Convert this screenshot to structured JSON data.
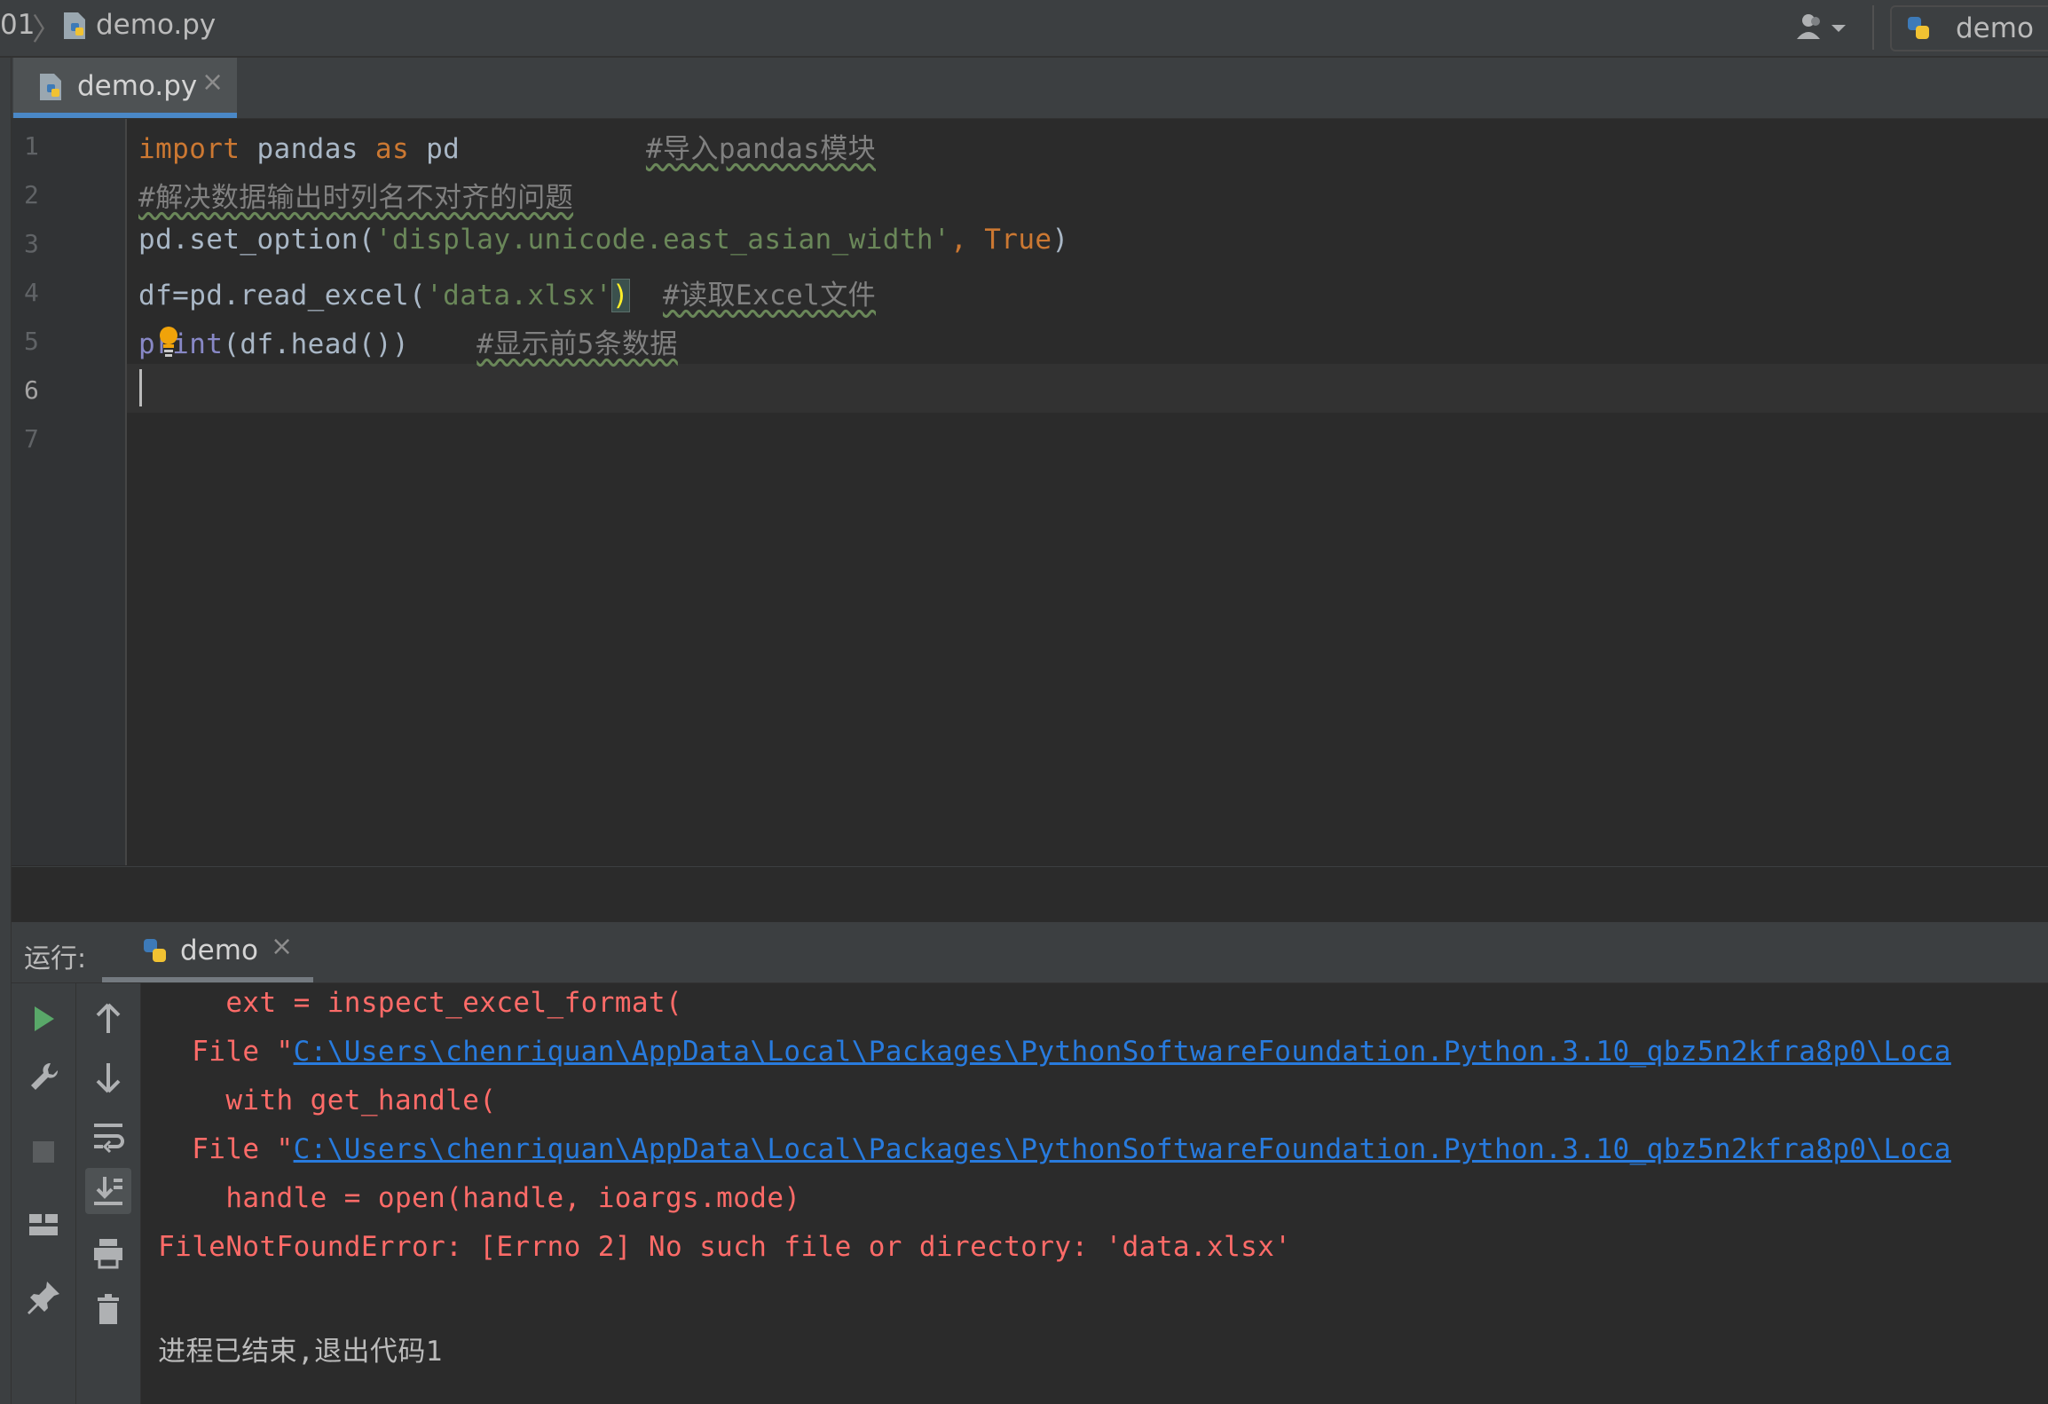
{
  "navbar": {
    "crumb_root": "01",
    "crumb_file": "demo.py",
    "run_config": "demo"
  },
  "tab": {
    "label": "demo.py",
    "close": "×"
  },
  "editor": {
    "line_numbers": [
      "1",
      "2",
      "3",
      "4",
      "5",
      "6",
      "7"
    ],
    "line1": {
      "import": "import",
      "mid": " pandas ",
      "as": "as",
      "end": " pd",
      "pad": "           ",
      "comment": "#导入pandas模块"
    },
    "line2": {
      "comment": "#解决数据输出时列名不对齐的问题"
    },
    "line3": {
      "pre": "pd.set_option(",
      "str": "'display.unicode.east_asian_width'",
      "comma": ", ",
      "true": "True",
      "end": ")"
    },
    "line4": {
      "pre": "df=pd.read_excel(",
      "str": "'data.xlsx'",
      "close": ")",
      "pad": "  ",
      "comment": "#读取Excel文件"
    },
    "line5": {
      "print": "print",
      "rest": "(df.head())",
      "pad": "    ",
      "comment": "#显示前5条数据"
    }
  },
  "run_panel": {
    "title": "运行:",
    "tab_label": "demo",
    "tab_close": "×"
  },
  "console": {
    "line1": "     ext = inspect_excel_format(",
    "line2_pre": "   File \"",
    "line2_link": "C:\\Users\\chenriquan\\AppData\\Local\\Packages\\PythonSoftwareFoundation.Python.3.10_qbz5n2kfra8p0\\Loca",
    "line3": "     with get_handle(",
    "line4_pre": "   File \"",
    "line4_link": "C:\\Users\\chenriquan\\AppData\\Local\\Packages\\PythonSoftwareFoundation.Python.3.10_qbz5n2kfra8p0\\Loca",
    "line5": "     handle = open(handle, ioargs.mode)",
    "line6": " FileNotFoundError: [Errno 2] No such file or directory: 'data.xlsx'",
    "line7": " 进程已结束,退出代码1"
  },
  "colors": {
    "keyword": "#cc7832",
    "string": "#6a8759",
    "comment": "#808080",
    "error": "#ff6b68",
    "link": "#287bde",
    "run_green": "#59a869"
  }
}
